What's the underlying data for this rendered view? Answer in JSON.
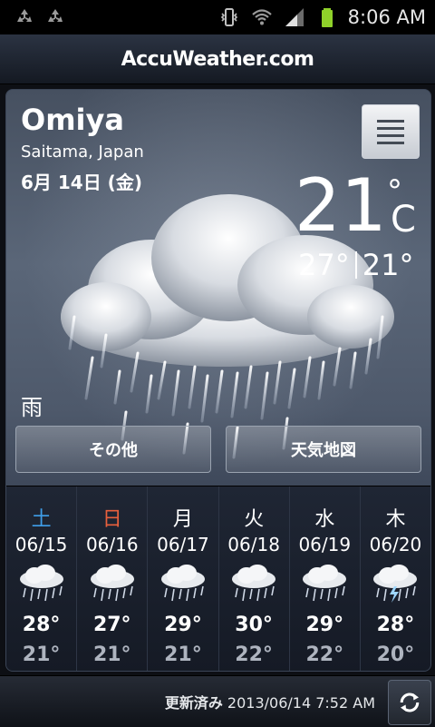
{
  "status_bar": {
    "time": "8:06 AM",
    "icons": [
      "recycle-icon",
      "recycle-icon",
      "vibrate-icon",
      "wifi-icon",
      "signal-icon",
      "battery-icon"
    ]
  },
  "header": {
    "title": "AccuWeather.com"
  },
  "location": {
    "city": "Omiya",
    "region": "Saitama, Japan",
    "date": "6月 14日 (金)"
  },
  "current": {
    "temp": "21",
    "deg_symbol": "°",
    "unit": "C",
    "high": "27°",
    "low": "21°",
    "condition": "雨",
    "icon": "rain-cloud-icon"
  },
  "buttons": {
    "other": "その他",
    "map": "天気地図"
  },
  "forecast": [
    {
      "dow": "土",
      "date": "06/15",
      "hi": "28°",
      "lo": "21°",
      "icon": "rain-cloud-icon"
    },
    {
      "dow": "日",
      "date": "06/16",
      "hi": "27°",
      "lo": "21°",
      "icon": "rain-cloud-icon"
    },
    {
      "dow": "月",
      "date": "06/17",
      "hi": "29°",
      "lo": "21°",
      "icon": "rain-cloud-icon"
    },
    {
      "dow": "火",
      "date": "06/18",
      "hi": "30°",
      "lo": "22°",
      "icon": "rain-cloud-icon"
    },
    {
      "dow": "水",
      "date": "06/19",
      "hi": "29°",
      "lo": "22°",
      "icon": "rain-cloud-icon"
    },
    {
      "dow": "木",
      "date": "06/20",
      "hi": "28°",
      "lo": "20°",
      "icon": "thunderstorm-cloud-icon"
    }
  ],
  "footer": {
    "updated_label": "更新済み",
    "updated_time": "2013/06/14 7:52 AM"
  },
  "colors": {
    "saturday": "#3f9ee9",
    "sunday": "#e8603d",
    "battery": "#8fd12a"
  }
}
